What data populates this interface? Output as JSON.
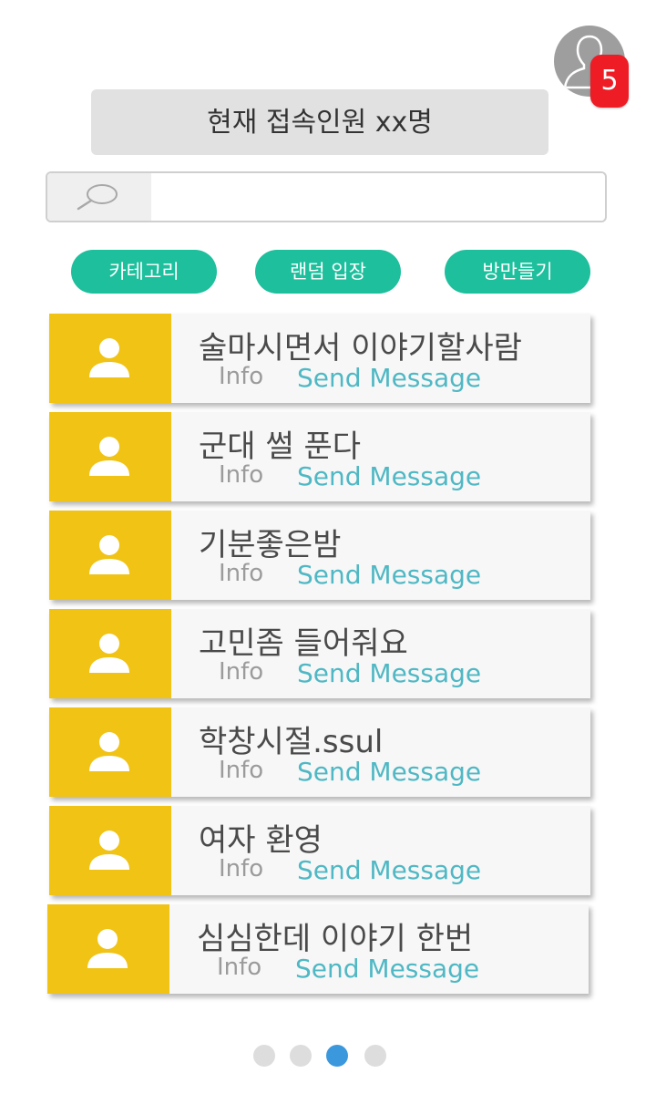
{
  "header": {
    "notification_count": "5",
    "online_text": "현재 접속인원 xx명"
  },
  "search": {
    "value": "",
    "placeholder": ""
  },
  "actions": {
    "category": "카테고리",
    "random_enter": "랜덤 입장",
    "create_room": "방만들기"
  },
  "rooms": [
    {
      "title": "술마시면서 이야기할사람",
      "info": "Info",
      "send": "Send Message"
    },
    {
      "title": "군대 썰 푼다",
      "info": "Info",
      "send": "Send Message"
    },
    {
      "title": "기분좋은밤",
      "info": "Info",
      "send": "Send Message"
    },
    {
      "title": "고민좀 들어줘요",
      "info": "Info",
      "send": "Send Message"
    },
    {
      "title": "학창시절.ssul",
      "info": "Info",
      "send": "Send Message"
    },
    {
      "title": "여자 환영",
      "info": "Info",
      "send": "Send Message"
    },
    {
      "title": "심심한데 이야기 한번",
      "info": "Info",
      "send": "Send Message"
    }
  ],
  "pagination": {
    "total_pages": 4,
    "current_page": 3
  },
  "colors": {
    "accent_green": "#1dbf9c",
    "card_thumb_yellow": "#f0c315",
    "link_teal": "#4fb8c4",
    "badge_red": "#ee1c25",
    "active_dot_blue": "#3c98dc"
  }
}
